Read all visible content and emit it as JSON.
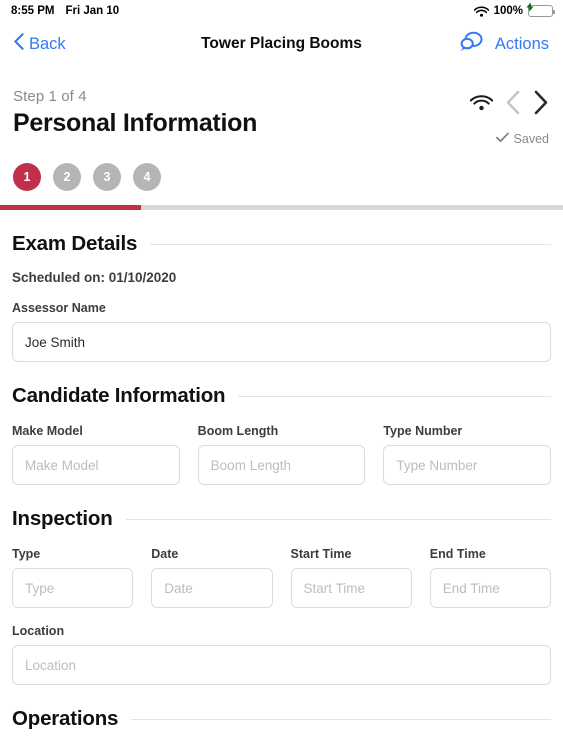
{
  "status_bar": {
    "time": "8:55 PM",
    "date": "Fri Jan 10",
    "battery_percent": "100%",
    "wifi_icon": "wifi-icon",
    "battery_icon": "battery-charging-icon"
  },
  "navbar": {
    "back_label": "Back",
    "title": "Tower Placing Booms",
    "actions_label": "Actions",
    "comments_icon": "comments-icon",
    "back_icon": "chevron-left-icon",
    "accent_color": "#3478f6"
  },
  "step_header": {
    "step_label": "Step 1 of 4",
    "title": "Personal Information",
    "saved_label": "Saved",
    "saved_icon": "check-icon",
    "wifi_icon": "wifi-icon",
    "prev_icon": "chevron-left-icon",
    "next_icon": "chevron-right-icon"
  },
  "stepper": {
    "steps": [
      {
        "label": "1",
        "active": true
      },
      {
        "label": "2",
        "active": false
      },
      {
        "label": "3",
        "active": false
      },
      {
        "label": "4",
        "active": false
      }
    ],
    "progress_percent": 25,
    "active_color": "#c0304a",
    "inactive_color": "#b5b5b5",
    "track_color": "#d8d8d8"
  },
  "sections": {
    "exam_details": {
      "title": "Exam Details",
      "scheduled_text": "Scheduled on: 01/10/2020",
      "assessor_label": "Assessor Name",
      "assessor_value": "Joe Smith",
      "assessor_placeholder": "Assessor Name"
    },
    "candidate_information": {
      "title": "Candidate Information",
      "fields": [
        {
          "label": "Make Model",
          "placeholder": "Make Model",
          "value": ""
        },
        {
          "label": "Boom Length",
          "placeholder": "Boom Length",
          "value": ""
        },
        {
          "label": "Type Number",
          "placeholder": "Type Number",
          "value": ""
        }
      ]
    },
    "inspection": {
      "title": "Inspection",
      "fields": [
        {
          "label": "Type",
          "placeholder": "Type",
          "value": ""
        },
        {
          "label": "Date",
          "placeholder": "Date",
          "value": ""
        },
        {
          "label": "Start Time",
          "placeholder": "Start Time",
          "value": ""
        },
        {
          "label": "End Time",
          "placeholder": "End Time",
          "value": ""
        }
      ],
      "location_label": "Location",
      "location_placeholder": "Location",
      "location_value": ""
    },
    "operations": {
      "title": "Operations"
    }
  }
}
